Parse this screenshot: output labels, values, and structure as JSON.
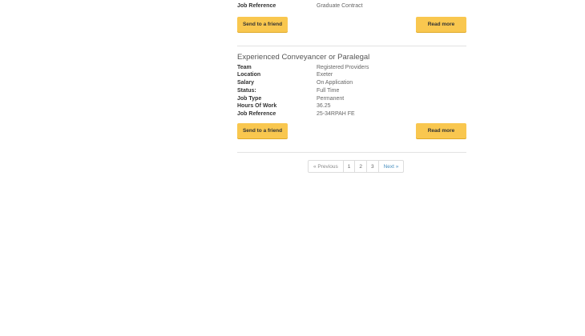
{
  "job1": {
    "fields": [
      {
        "label": "Job Reference",
        "value": "Graduate Contract"
      }
    ],
    "send_label": "Send to a friend",
    "read_label": "Read more"
  },
  "job2": {
    "title": "Experienced Conveyancer or Paralegal",
    "fields": [
      {
        "label": "Team",
        "value": "Registered Providers"
      },
      {
        "label": "Location",
        "value": "Exeter"
      },
      {
        "label": "Salary",
        "value": "On Application"
      },
      {
        "label": "Status:",
        "value": "Full Time"
      },
      {
        "label": "Job Type",
        "value": "Permanent"
      },
      {
        "label": "Hours Of Work",
        "value": "36.25"
      },
      {
        "label": "Job Reference",
        "value": "25-34RPAH FE"
      }
    ],
    "send_label": "Send to a friend",
    "read_label": "Read more"
  },
  "pagination": {
    "previous": "« Previous",
    "pages": [
      "1",
      "2",
      "3"
    ],
    "next": "Next »"
  }
}
